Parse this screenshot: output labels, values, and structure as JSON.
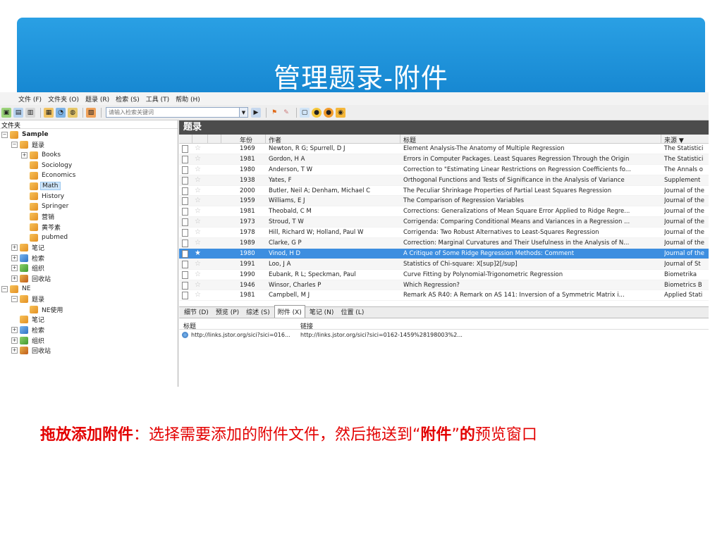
{
  "slide": {
    "title": "管理题录-附件",
    "caption_parts": [
      {
        "text": "拖放添加附件",
        "bold": true
      },
      {
        "text": "：选择需要添加的附件文件，然后拖送到“",
        "bold": false
      },
      {
        "text": "附件",
        "bold": true
      },
      {
        "text": "”",
        "bold": false
      },
      {
        "text": "的",
        "bold": true
      },
      {
        "text": "预览窗口",
        "bold": false
      }
    ]
  },
  "menu": [
    "文件 (F)",
    "文件夹 (O)",
    "题录 (R)",
    "检索 (S)",
    "工具 (T)",
    "帮助 (H)"
  ],
  "search": {
    "placeholder": "请输入检索关键词"
  },
  "tree": {
    "header": "文件夹",
    "items": [
      {
        "label": "Sample",
        "bold": true,
        "level": 0,
        "exp": "-",
        "icon": "folder"
      },
      {
        "label": "题录",
        "level": 1,
        "exp": "-",
        "icon": "folder"
      },
      {
        "label": "Books",
        "level": 2,
        "exp": "+",
        "icon": "folder"
      },
      {
        "label": "Sociology",
        "level": 2,
        "exp": "",
        "icon": "folder"
      },
      {
        "label": "Economics",
        "level": 2,
        "exp": "",
        "icon": "folder"
      },
      {
        "label": "Math",
        "level": 2,
        "exp": "",
        "icon": "folder",
        "selected": true
      },
      {
        "label": "History",
        "level": 2,
        "exp": "",
        "icon": "folder"
      },
      {
        "label": "Springer",
        "level": 2,
        "exp": "",
        "icon": "folder"
      },
      {
        "label": "营销",
        "level": 2,
        "exp": "",
        "icon": "folder"
      },
      {
        "label": "黄芩素",
        "level": 2,
        "exp": "",
        "icon": "folder"
      },
      {
        "label": "pubmed",
        "level": 2,
        "exp": "",
        "icon": "folder"
      },
      {
        "label": "笔记",
        "level": 1,
        "exp": "+",
        "icon": "folder"
      },
      {
        "label": "检索",
        "level": 1,
        "exp": "+",
        "icon": "blue"
      },
      {
        "label": "组织",
        "level": 1,
        "exp": "+",
        "icon": "green"
      },
      {
        "label": "回收站",
        "level": 1,
        "exp": "+",
        "icon": "trash"
      },
      {
        "label": "NE",
        "level": 0,
        "exp": "-",
        "icon": "folder"
      },
      {
        "label": "题录",
        "level": 1,
        "exp": "-",
        "icon": "folder"
      },
      {
        "label": "NE使用",
        "level": 2,
        "exp": "",
        "icon": "folder"
      },
      {
        "label": "笔记",
        "level": 1,
        "exp": "",
        "icon": "folder"
      },
      {
        "label": "检索",
        "level": 1,
        "exp": "+",
        "icon": "blue"
      },
      {
        "label": "组织",
        "level": 1,
        "exp": "+",
        "icon": "green"
      },
      {
        "label": "回收站",
        "level": 1,
        "exp": "+",
        "icon": "trash"
      }
    ]
  },
  "refs": {
    "pane_title": "题录",
    "columns": {
      "year": "年份",
      "author": "作者",
      "title": "标题",
      "source": "来源 ▼"
    },
    "rows": [
      {
        "year": "1969",
        "author": "Newton, R G; Spurrell, D J",
        "title": "Element Analysis-The Anatomy of Multiple Regression",
        "source": "The Statistici"
      },
      {
        "year": "1981",
        "author": "Gordon, H A",
        "title": "Errors in Computer Packages. Least Squares Regression Through the Origin",
        "source": "The Statistici"
      },
      {
        "year": "1980",
        "author": "Anderson, T W",
        "title": "Correction to \"Estimating Linear Restrictions on Regression Coefficients fo...",
        "source": "The Annals o"
      },
      {
        "year": "1938",
        "author": "Yates, F",
        "title": "Orthogonal Functions and Tests of Significance in the Analysis of Variance",
        "source": "Supplement"
      },
      {
        "year": "2000",
        "author": "Butler, Neil A; Denham, Michael C",
        "title": "The Peculiar Shrinkage Properties of Partial Least Squares Regression",
        "source": "Journal of the"
      },
      {
        "year": "1959",
        "author": "Williams, E J",
        "title": "The Comparison of Regression Variables",
        "source": "Journal of the"
      },
      {
        "year": "1981",
        "author": "Theobald, C M",
        "title": "Corrections: Generalizations of Mean Square Error Applied to Ridge Regre...",
        "source": "Journal of the"
      },
      {
        "year": "1973",
        "author": "Stroud, T W",
        "title": "Corrigenda: Comparing Conditional Means and Variances in a Regression ...",
        "source": "Journal of the"
      },
      {
        "year": "1978",
        "author": "Hill, Richard W; Holland, Paul W",
        "title": "Corrigenda: Two Robust Alternatives to Least-Squares Regression",
        "source": "Journal of the"
      },
      {
        "year": "1989",
        "author": "Clarke, G P",
        "title": "Correction: Marginal Curvatures and Their Usefulness in the Analysis of N...",
        "source": "Journal of the"
      },
      {
        "year": "1980",
        "author": "Vinod, H D",
        "title": "A Critique of Some Ridge Regression Methods: Comment",
        "source": "Journal of the",
        "selected": true
      },
      {
        "year": "1991",
        "author": "Loo, J A",
        "title": "Statistics of Chi-square: X[sup]2[/sup]",
        "source": "Journal of St"
      },
      {
        "year": "1990",
        "author": "Eubank, R L; Speckman, Paul",
        "title": "Curve Fitting by Polynomial-Trigonometric Regression",
        "source": "Biometrika"
      },
      {
        "year": "1946",
        "author": "Winsor, Charles P",
        "title": "Which Regression?",
        "source": "Biometrics B"
      },
      {
        "year": "1981",
        "author": "Campbell, M J",
        "title": "Remark AS R40: A Remark on AS 141: Inversion of a Symmetric Matrix i...",
        "source": "Applied Stati"
      }
    ]
  },
  "tabs": [
    "细节 (D)",
    "预览 (P)",
    "综述 (S)",
    "附件 (X)",
    "笔记 (N)",
    "位置 (L)"
  ],
  "active_tab": 3,
  "attachments": {
    "columns": {
      "title": "标题",
      "link": "链接"
    },
    "rows": [
      {
        "title": "http://links.jstor.org/sici?sici=016...",
        "link": "http://links.jstor.org/sici?sici=0162-1459%28198003%2..."
      }
    ]
  },
  "colors": {
    "banner": "#1b8fd8",
    "selection": "#3d8ee0",
    "caption": "#e30000"
  }
}
